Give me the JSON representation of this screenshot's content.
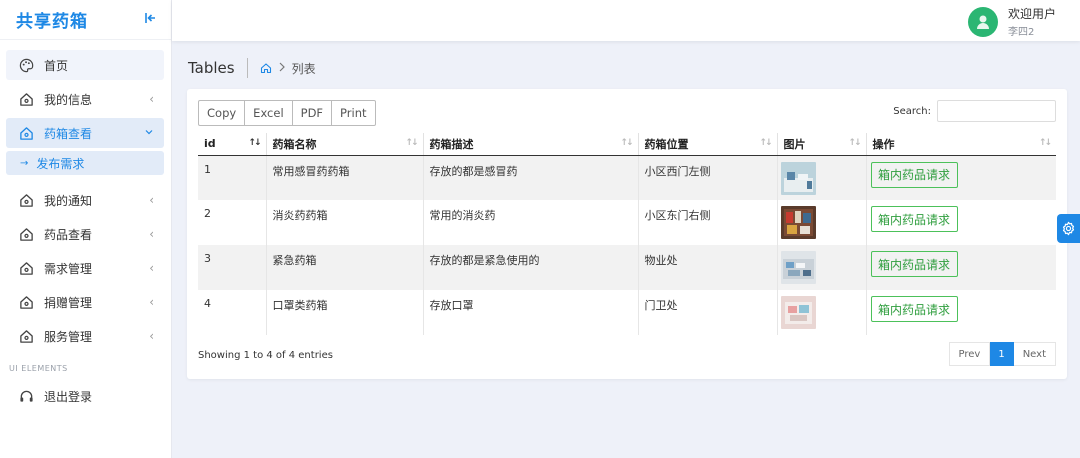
{
  "app": {
    "title": "共享药箱"
  },
  "sidebar": {
    "items": [
      {
        "label": "首页"
      },
      {
        "label": "我的信息"
      },
      {
        "label": "药箱查看"
      },
      {
        "label": "我的通知"
      },
      {
        "label": "药品查看"
      },
      {
        "label": "需求管理"
      },
      {
        "label": "捐赠管理"
      },
      {
        "label": "服务管理"
      }
    ],
    "active_sub": {
      "label": "发布需求"
    },
    "section_label": "UI ELEMENTS",
    "logout": {
      "label": "退出登录"
    }
  },
  "header": {
    "welcome": "欢迎用户",
    "username": "李四2"
  },
  "page": {
    "title": "Tables",
    "breadcrumb": "列表"
  },
  "toolbar": {
    "buttons": [
      "Copy",
      "Excel",
      "PDF",
      "Print"
    ],
    "search_label": "Search:",
    "search_placeholder": ""
  },
  "table": {
    "columns": [
      "id",
      "药箱名称",
      "药箱描述",
      "药箱位置",
      "图片",
      "操作"
    ],
    "rows": [
      {
        "id": "1",
        "name": "常用感冒药药箱",
        "desc": "存放的都是感冒药",
        "location": "小区西门左侧",
        "action": "箱内药品请求"
      },
      {
        "id": "2",
        "name": "消炎药药箱",
        "desc": "常用的消炎药",
        "location": "小区东门右侧",
        "action": "箱内药品请求"
      },
      {
        "id": "3",
        "name": "紧急药箱",
        "desc": "存放的都是紧急使用的",
        "location": "物业处",
        "action": "箱内药品请求"
      },
      {
        "id": "4",
        "name": "口罩类药箱",
        "desc": "存放口罩",
        "location": "门卫处",
        "action": "箱内药品请求"
      }
    ]
  },
  "footer": {
    "info": "Showing 1 to 4 of 4 entries",
    "prev": "Prev",
    "page": "1",
    "next": "Next"
  },
  "colors": {
    "accent": "#1e88e5",
    "success": "#4cc15a",
    "avatar": "#2bb673"
  }
}
